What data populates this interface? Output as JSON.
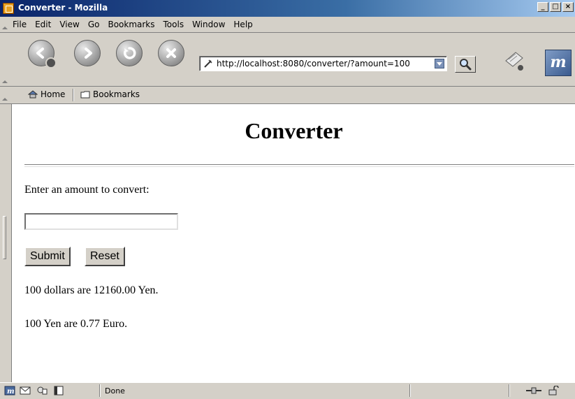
{
  "window": {
    "title": "Converter - Mozilla",
    "buttons": [
      "_",
      "□",
      "×"
    ]
  },
  "menubar": {
    "items": [
      "File",
      "Edit",
      "View",
      "Go",
      "Bookmarks",
      "Tools",
      "Window",
      "Help"
    ]
  },
  "navigation": {
    "back_icon": "back-arrow-icon",
    "forward_icon": "forward-arrow-icon",
    "reload_icon": "reload-icon",
    "stop_icon": "stop-icon",
    "url": "http://localhost:8080/converter/?amount=100",
    "search_icon": "search-icon",
    "print_icon": "printer-icon",
    "throbber_label": "m"
  },
  "bookmarks_bar": {
    "home_label": "Home",
    "bookmarks_label": "Bookmarks"
  },
  "page": {
    "heading": "Converter",
    "prompt": "Enter an amount to convert:",
    "input_value": "",
    "submit_label": "Submit",
    "reset_label": "Reset",
    "result_yen": "100 dollars are 12160.00 Yen.",
    "result_euro": "100 Yen are 0.77 Euro."
  },
  "statusbar": {
    "status_text": "Done"
  }
}
